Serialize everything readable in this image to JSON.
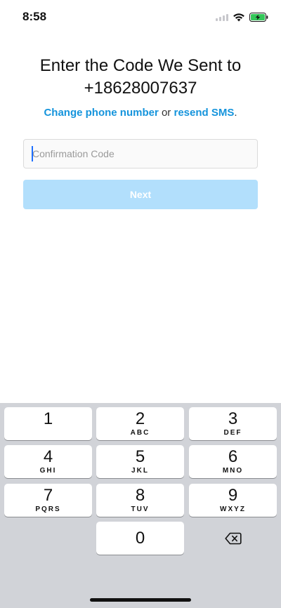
{
  "status_bar": {
    "time": "8:58",
    "battery_color": "#34c759"
  },
  "title": {
    "line1": "Enter the Code We Sent to",
    "line2": "+18628007637"
  },
  "links": {
    "change": "Change phone number",
    "or": " or ",
    "resend": "resend SMS",
    "period": "."
  },
  "code_input": {
    "placeholder": "Confirmation Code",
    "value": ""
  },
  "next_button": {
    "label": "Next"
  },
  "keyboard": {
    "keys": [
      {
        "digit": "1",
        "letters": ""
      },
      {
        "digit": "2",
        "letters": "ABC"
      },
      {
        "digit": "3",
        "letters": "DEF"
      },
      {
        "digit": "4",
        "letters": "GHI"
      },
      {
        "digit": "5",
        "letters": "JKL"
      },
      {
        "digit": "6",
        "letters": "MNO"
      },
      {
        "digit": "7",
        "letters": "PQRS"
      },
      {
        "digit": "8",
        "letters": "TUV"
      },
      {
        "digit": "9",
        "letters": "WXYZ"
      },
      {
        "digit": "0",
        "letters": ""
      }
    ],
    "delete_icon": "backspace-icon"
  },
  "colors": {
    "accent": "#1594dc",
    "button_disabled": "#b2dffc",
    "keyboard_bg": "#d1d3d8"
  }
}
